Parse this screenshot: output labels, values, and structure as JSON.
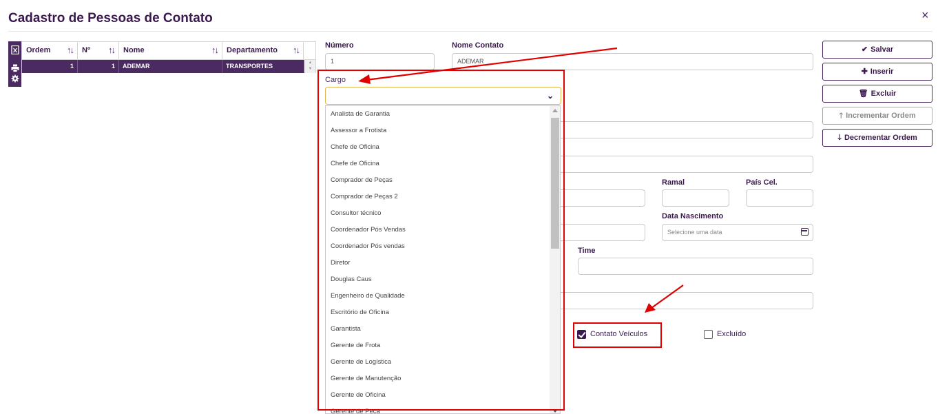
{
  "header": {
    "title": "Cadastro de Pessoas de Contato",
    "close_icon": "×"
  },
  "grid": {
    "columns": [
      "Ordem",
      "Nº",
      "Nome",
      "Departamento"
    ],
    "rows": [
      {
        "ordem": "1",
        "numero": "1",
        "nome": "ADEMAR",
        "departamento": "TRANSPORTES"
      }
    ]
  },
  "form": {
    "numero_label": "Número",
    "numero_value": "1",
    "nome_contato_label": "Nome Contato",
    "nome_contato_value": "ADEMAR",
    "cargo_label": "Cargo",
    "cargo_value": "",
    "ramal_label": "Ramal",
    "pais_cel_label": "País Cel.",
    "data_nascimento_label": "Data Nascimento",
    "data_nascimento_placeholder": "Selecione uma data",
    "time_label": "Time",
    "contato_veiculos_label": "Contato Veículos",
    "contato_veiculos_checked": true,
    "excluido_label": "Excluído",
    "excluido_checked": false
  },
  "cargo_options": [
    "Analista de Garantia",
    "Assessor a Frotista",
    "Chefe de Oficina",
    "Chefe de Oficina",
    "Comprador de Peças",
    "Comprador de Peças 2",
    "Consultor técnico",
    "Coordenador Pós Vendas",
    "Coordenador Pós vendas",
    "Diretor",
    "Douglas Caus",
    "Engenheiro de Qualidade",
    "Escritório de Oficina",
    "Garantista",
    "Gerente de Frota",
    "Gerente de Logística",
    "Gerente de Manutenção",
    "Gerente de Oficina",
    "Gerente de Peça"
  ],
  "buttons": {
    "salvar": "Salvar",
    "inserir": "Inserir",
    "excluir": "Excluir",
    "incrementar": "Incrementar Ordem",
    "decrementar": "Decrementar Ordem"
  },
  "colors": {
    "brand": "#4a2a60",
    "annotation": "#e00000",
    "focus": "#e2b54a"
  }
}
